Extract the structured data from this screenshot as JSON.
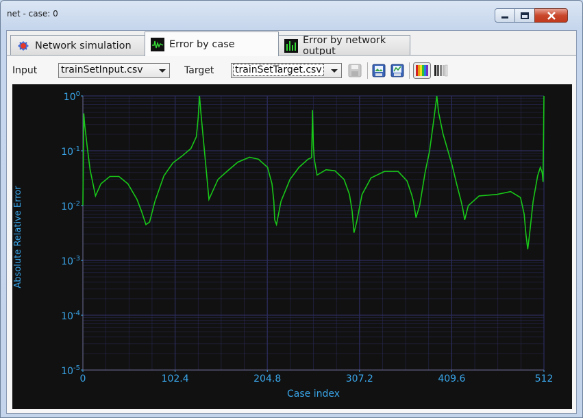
{
  "window": {
    "title": "net - case: 0"
  },
  "tabs": [
    {
      "label": "Network simulation",
      "icon": "network-simulation-icon"
    },
    {
      "label": "Error by case",
      "icon": "error-waveform-icon"
    },
    {
      "label": "Error by network output",
      "icon": "error-bars-icon"
    }
  ],
  "toolbar": {
    "input_label": "Input",
    "input_value": "trainSetInput.csv",
    "target_label": "Target",
    "target_value": "trainSetTarget.csv",
    "icons": [
      "save-icon",
      "export-image-icon",
      "export-data-icon",
      "color-palette-icon",
      "grayscale-palette-icon"
    ]
  },
  "colors": {
    "plot_bg": "#111111",
    "grid": "#2c2c5e",
    "axis_text": "#3aa6ea",
    "series": "#18c718"
  },
  "chart_data": {
    "type": "line",
    "xlabel": "Case index",
    "ylabel": "Absolute Relative Error",
    "xlim": [
      0,
      512
    ],
    "ylim": [
      1e-05,
      1
    ],
    "yscale": "log",
    "grid": true,
    "x_ticks": [
      "0",
      "102.4",
      "204.8",
      "307.2",
      "409.6",
      "512"
    ],
    "y_ticks": [
      {
        "base": "10",
        "exp": "0"
      },
      {
        "base": "10",
        "exp": "-1"
      },
      {
        "base": "10",
        "exp": "-2"
      },
      {
        "base": "10",
        "exp": "-3"
      },
      {
        "base": "10",
        "exp": "-4"
      },
      {
        "base": "10",
        "exp": "-5"
      }
    ],
    "series": [
      {
        "x": [
          0,
          1,
          2,
          5,
          8,
          14,
          20,
          30,
          40,
          50,
          60,
          65,
          70,
          74,
          80,
          90,
          100,
          110,
          120,
          126,
          128,
          129.5,
          131,
          134,
          140,
          150,
          160,
          172,
          185,
          195,
          205,
          210,
          212,
          213,
          215,
          220,
          230,
          240,
          250,
          254,
          255,
          256,
          257,
          260,
          270,
          280,
          290,
          296,
          299,
          301,
          304,
          310,
          320,
          335,
          350,
          360,
          365,
          367,
          370,
          374,
          380,
          385,
          390,
          393,
          395,
          400,
          410,
          415,
          420,
          422,
          424,
          428,
          440,
          460,
          475,
          486,
          490,
          492,
          494,
          496,
          500,
          505,
          508,
          510,
          511,
          512
        ],
        "y": [
          0.01,
          0.48,
          0.3,
          0.11,
          0.045,
          0.015,
          0.025,
          0.034,
          0.034,
          0.025,
          0.013,
          0.008,
          0.0045,
          0.005,
          0.012,
          0.035,
          0.06,
          0.08,
          0.11,
          0.18,
          0.4,
          1.0,
          0.5,
          0.15,
          0.013,
          0.03,
          0.042,
          0.062,
          0.076,
          0.07,
          0.05,
          0.025,
          0.012,
          0.0055,
          0.0045,
          0.012,
          0.03,
          0.05,
          0.07,
          0.075,
          0.55,
          0.12,
          0.07,
          0.036,
          0.045,
          0.043,
          0.03,
          0.016,
          0.008,
          0.0032,
          0.005,
          0.016,
          0.032,
          0.042,
          0.042,
          0.028,
          0.016,
          0.012,
          0.006,
          0.01,
          0.04,
          0.1,
          0.4,
          1.0,
          0.5,
          0.2,
          0.055,
          0.025,
          0.012,
          0.0085,
          0.0055,
          0.01,
          0.015,
          0.016,
          0.018,
          0.014,
          0.007,
          0.003,
          0.0016,
          0.003,
          0.012,
          0.035,
          0.05,
          0.04,
          0.027,
          1.0
        ]
      }
    ]
  }
}
